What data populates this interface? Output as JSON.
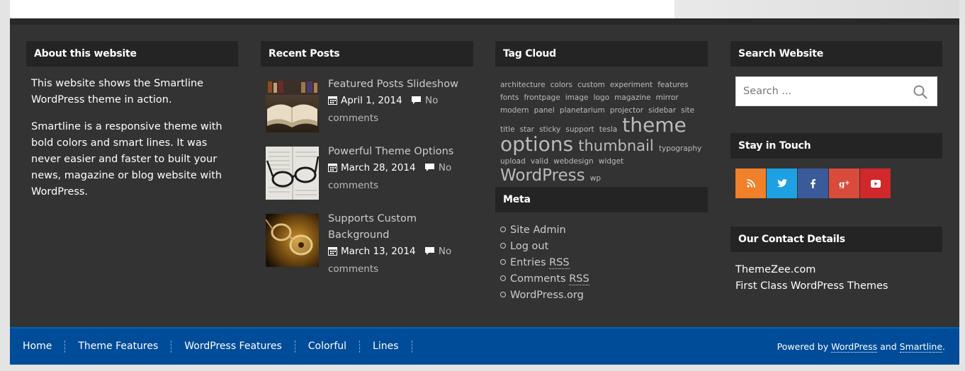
{
  "widgets": {
    "about": {
      "title": "About this website",
      "p1": "This website shows the Smartline WordPress theme in action.",
      "p2": "Smartline is a responsive theme with bold colors and smart lines. It was never easier and faster to built your news, magazine or blog website with WordPress."
    },
    "recent_posts": {
      "title": "Recent Posts",
      "posts": [
        {
          "title": "Featured Posts Slideshow",
          "date": "April 1, 2014",
          "comments": "No comments"
        },
        {
          "title": "Powerful Theme Options",
          "date": "March 28, 2014",
          "comments": "No comments"
        },
        {
          "title": "Supports Custom Background",
          "date": "March 13, 2014",
          "comments": "No comments"
        }
      ]
    },
    "tag_cloud": {
      "title": "Tag Cloud",
      "tags": {
        "architecture": "architecture",
        "colors": "colors",
        "custom": "custom",
        "experiment": "experiment",
        "features": "features",
        "fonts": "fonts",
        "frontpage": "frontpage",
        "image": "image",
        "logo": "logo",
        "magazine": "magazine",
        "mirror": "mirror",
        "modern": "modern",
        "panel": "panel",
        "planetarium": "planetarium",
        "projector": "projector",
        "sidebar": "sidebar",
        "site_title": "site title",
        "star": "star",
        "sticky": "sticky",
        "support": "support",
        "tesla": "tesla",
        "theme_options": "theme options",
        "thumbnail": "thumbnail",
        "typography": "typography",
        "upload": "upload",
        "valid": "valid",
        "webdesign": "webdesign",
        "widget": "widget",
        "wordpress": "WordPress",
        "wp": "wp"
      }
    },
    "meta": {
      "title": "Meta",
      "items": [
        "Site Admin",
        "Log out",
        "Entries",
        "Comments"
      ],
      "rss": "RSS",
      "wordpress_org": "WordPress.org"
    },
    "search": {
      "title": "Search Website",
      "placeholder": "Search ...",
      "icon": "search-icon"
    },
    "stay_in_touch": {
      "title": "Stay in Touch",
      "networks": [
        {
          "name": "rss",
          "glyph": "◥",
          "color": "#f0802a"
        },
        {
          "name": "twitter",
          "glyph": "✈",
          "color": "#1da1e2"
        },
        {
          "name": "facebook",
          "glyph": "f",
          "color": "#3b5a9a"
        },
        {
          "name": "google-plus",
          "glyph": "g+",
          "color": "#d94c3c"
        },
        {
          "name": "youtube",
          "glyph": "▶",
          "color": "#d0282b"
        }
      ]
    },
    "contact": {
      "title": "Our Contact Details",
      "line1": "ThemeZee.com",
      "line2": "First Class WordPress Themes"
    }
  },
  "footer": {
    "nav": [
      "Home",
      "Theme Features",
      "WordPress Features",
      "Colorful",
      "Lines"
    ],
    "credit": {
      "powered_by": "Powered by",
      "wordpress": "WordPress",
      "and": "and",
      "smartline": "Smartline",
      "period": "."
    }
  },
  "colors": {
    "widget_bg": "#333333",
    "title_bg": "#242424",
    "footer_bar": "#004c99"
  }
}
